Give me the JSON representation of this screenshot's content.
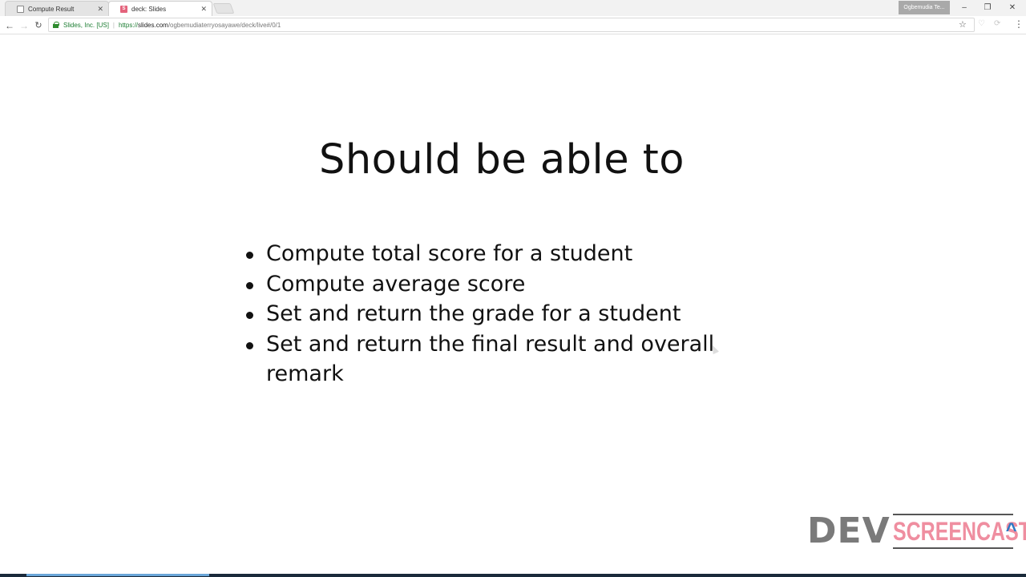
{
  "browser": {
    "tabs": [
      {
        "title": "Compute Result",
        "close": "✕"
      },
      {
        "title": "deck: Slides",
        "favicon_letter": "S",
        "close": "✕"
      }
    ],
    "profile_name": "Ogbemudia Te...",
    "window_controls": {
      "minimize": "–",
      "restore": "❐",
      "close": "✕"
    },
    "nav": {
      "back": "←",
      "forward": "→",
      "reload": "↻"
    },
    "address": {
      "secure_org": "Slides, Inc. [US]",
      "separator": "|",
      "scheme": "https://",
      "host": "slides.com",
      "path": "/ogbemudiaterryosayawe/deck/live#/0/1"
    },
    "star": "☆",
    "menu": "⋮"
  },
  "slide": {
    "title": "Should be able to",
    "bullets": [
      "Compute total score for a student",
      "Compute average score",
      "Set and return the grade for a student",
      "Set and return the final result and overall remark"
    ]
  },
  "watermark": {
    "left": "DEV",
    "right": "SCREENCAST",
    "colors": {
      "dev": "#7a7a7a",
      "screencast": "#ef8ea0",
      "arrow": "#2d78c4"
    }
  }
}
